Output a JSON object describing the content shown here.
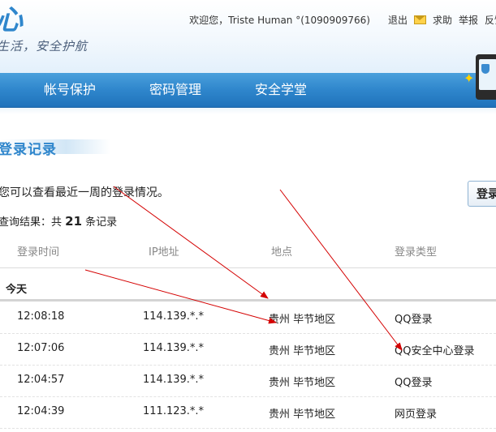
{
  "header": {
    "logo_glyph": "心",
    "slogan": "生活，安全护航",
    "welcome": "欢迎您，Triste  Human  °(1090909766)",
    "logout": "退出",
    "help": "求助",
    "report": "举报",
    "feedback": "反馈"
  },
  "nav": {
    "items": [
      {
        "label": "帐号保护"
      },
      {
        "label": "密码管理"
      },
      {
        "label": "安全学堂"
      }
    ]
  },
  "section": {
    "title": "登录记录",
    "description": "您可以查看最近一周的登录情况。",
    "search_button": "登录",
    "result_prefix": "查询结果：共",
    "result_count": "21",
    "result_suffix": "条记录"
  },
  "table": {
    "columns": [
      "登录时间",
      "IP地址",
      "地点",
      "登录类型"
    ],
    "group": "今天",
    "rows": [
      {
        "time": "12:08:18",
        "ip": "114.139.*.*",
        "location": "贵州  毕节地区",
        "type": "QQ登录"
      },
      {
        "time": "12:07:06",
        "ip": "114.139.*.*",
        "location": "贵州  毕节地区",
        "type": "QQ安全中心登录"
      },
      {
        "time": "12:04:57",
        "ip": "114.139.*.*",
        "location": "贵州  毕节地区",
        "type": "QQ登录"
      },
      {
        "time": "12:04:39",
        "ip": "111.123.*.*",
        "location": "贵州  毕节地区",
        "type": "网页登录"
      }
    ]
  },
  "colors": {
    "brand_blue": "#2f86cc",
    "annotation_red": "#d40000"
  }
}
